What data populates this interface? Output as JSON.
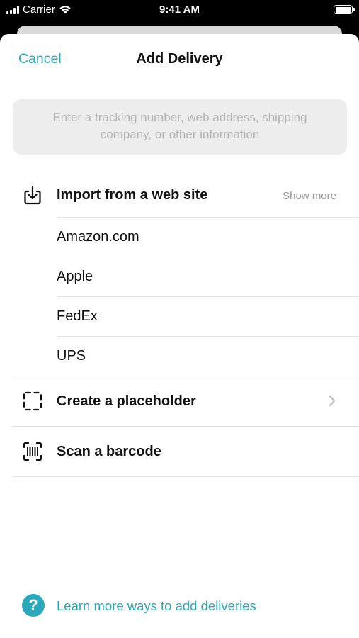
{
  "status_bar": {
    "carrier": "Carrier",
    "time": "9:41 AM"
  },
  "nav": {
    "cancel_label": "Cancel",
    "title": "Add Delivery"
  },
  "search": {
    "placeholder": "Enter a tracking number, web address, shipping company, or other information",
    "value": ""
  },
  "import_section": {
    "title": "Import from a web site",
    "show_more_label": "Show more",
    "sites": [
      "Amazon.com",
      "Apple",
      "FedEx",
      "UPS"
    ]
  },
  "actions": {
    "placeholder_label": "Create a placeholder",
    "barcode_label": "Scan a barcode"
  },
  "help": {
    "icon_glyph": "?",
    "link_label": "Learn more ways to add deliveries"
  },
  "colors": {
    "accent": "#2aa8bc",
    "text": "#111111",
    "secondary": "#9a9a9a"
  }
}
